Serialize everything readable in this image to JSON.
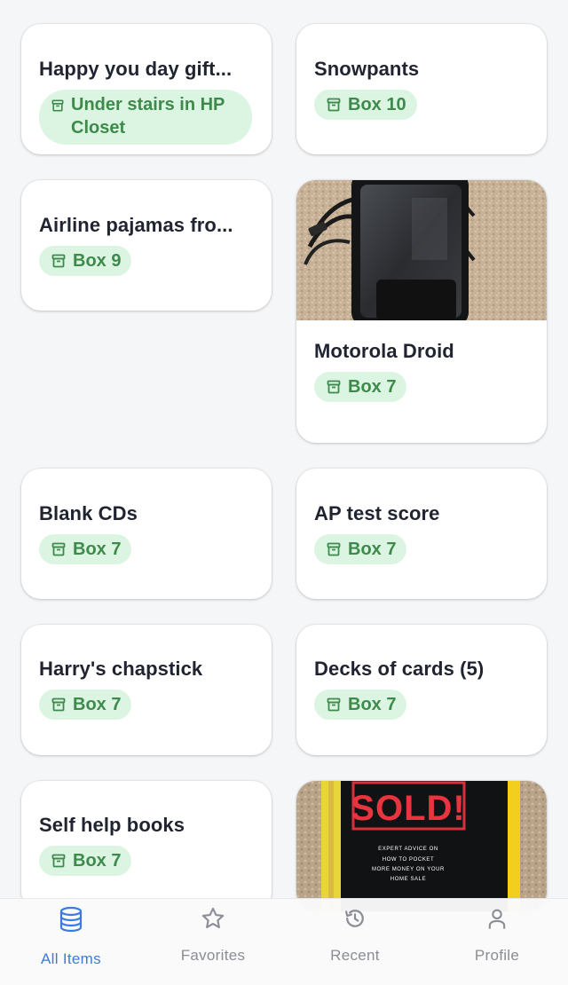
{
  "items": [
    {
      "name": "Happy you day gift...",
      "location": "Under stairs in HP Closet"
    },
    {
      "name": "Snowpants",
      "location": "Box 10"
    },
    {
      "name": "Airline pajamas fro...",
      "location": "Box 9"
    },
    {
      "name": "Motorola Droid",
      "location": "Box 7",
      "image": "photo of a black Motorola Droid phone with a charging cable on beige carpet"
    },
    {
      "name": "Blank CDs",
      "location": "Box 7"
    },
    {
      "name": "AP test score",
      "location": "Box 7"
    },
    {
      "name": "Harry's chapstick",
      "location": "Box 7"
    },
    {
      "name": "Decks of cards (5)",
      "location": "Box 7"
    },
    {
      "name": "Self help books",
      "location": "Box 7"
    },
    {
      "name": "",
      "location": "",
      "image": "photo of a black book cover reading SOLD!"
    }
  ],
  "book_cover": {
    "headline": "SOLD!",
    "lines": [
      "EXPERT ADVICE ON",
      "HOW TO POCKET",
      "MORE MONEY ON YOUR",
      "HOME SALE"
    ]
  },
  "tabs": [
    {
      "label": "All Items",
      "icon": "database-icon",
      "active": true
    },
    {
      "label": "Favorites",
      "icon": "star-icon",
      "active": false
    },
    {
      "label": "Recent",
      "icon": "history-icon",
      "active": false
    },
    {
      "label": "Profile",
      "icon": "person-icon",
      "active": false
    }
  ],
  "colors": {
    "badge_bg": "#dcf5e3",
    "badge_text": "#3e8a4b",
    "active_tab": "#3b7be0",
    "inactive_tab": "#8a8d94"
  }
}
